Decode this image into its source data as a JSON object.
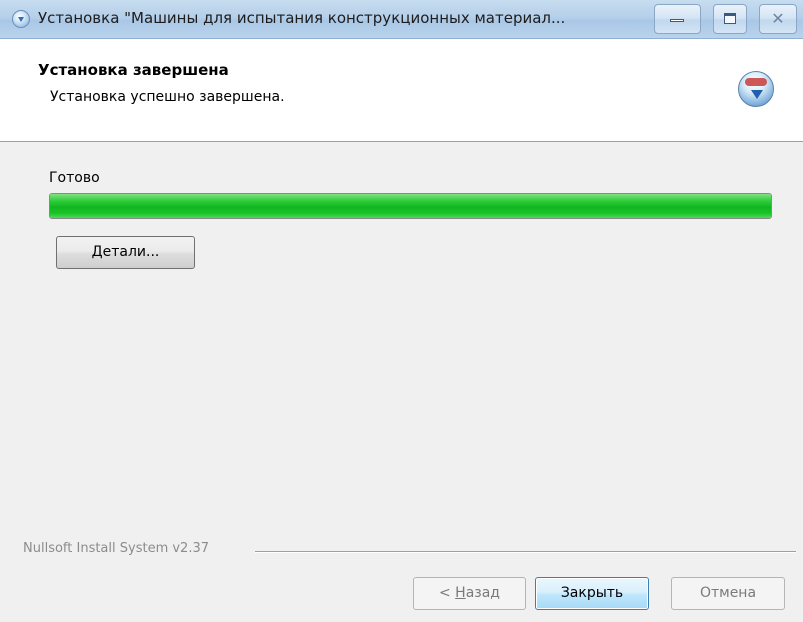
{
  "window": {
    "title": "Установка \"Машины для испытания конструкционных материал...",
    "controls": {
      "minimize": "minimize",
      "maximize": "maximize",
      "close": "✕"
    }
  },
  "header": {
    "title": "Установка завершена",
    "subtitle": "Установка успешно завершена.",
    "icon": "installer-icon"
  },
  "status": {
    "label": "Готово",
    "progress_fraction": 1.0,
    "progress_color": "#19c427"
  },
  "details_button": {
    "accel": "Д",
    "rest": "етали..."
  },
  "footer": {
    "brand": "Nullsoft Install System v2.37",
    "back_button": {
      "prefix": "< ",
      "accel": "Н",
      "rest": "азад",
      "enabled": false
    },
    "close_button": {
      "label": "Закрыть",
      "enabled": true,
      "default": true
    },
    "cancel_button": {
      "label": "Отмена",
      "enabled": false
    }
  }
}
